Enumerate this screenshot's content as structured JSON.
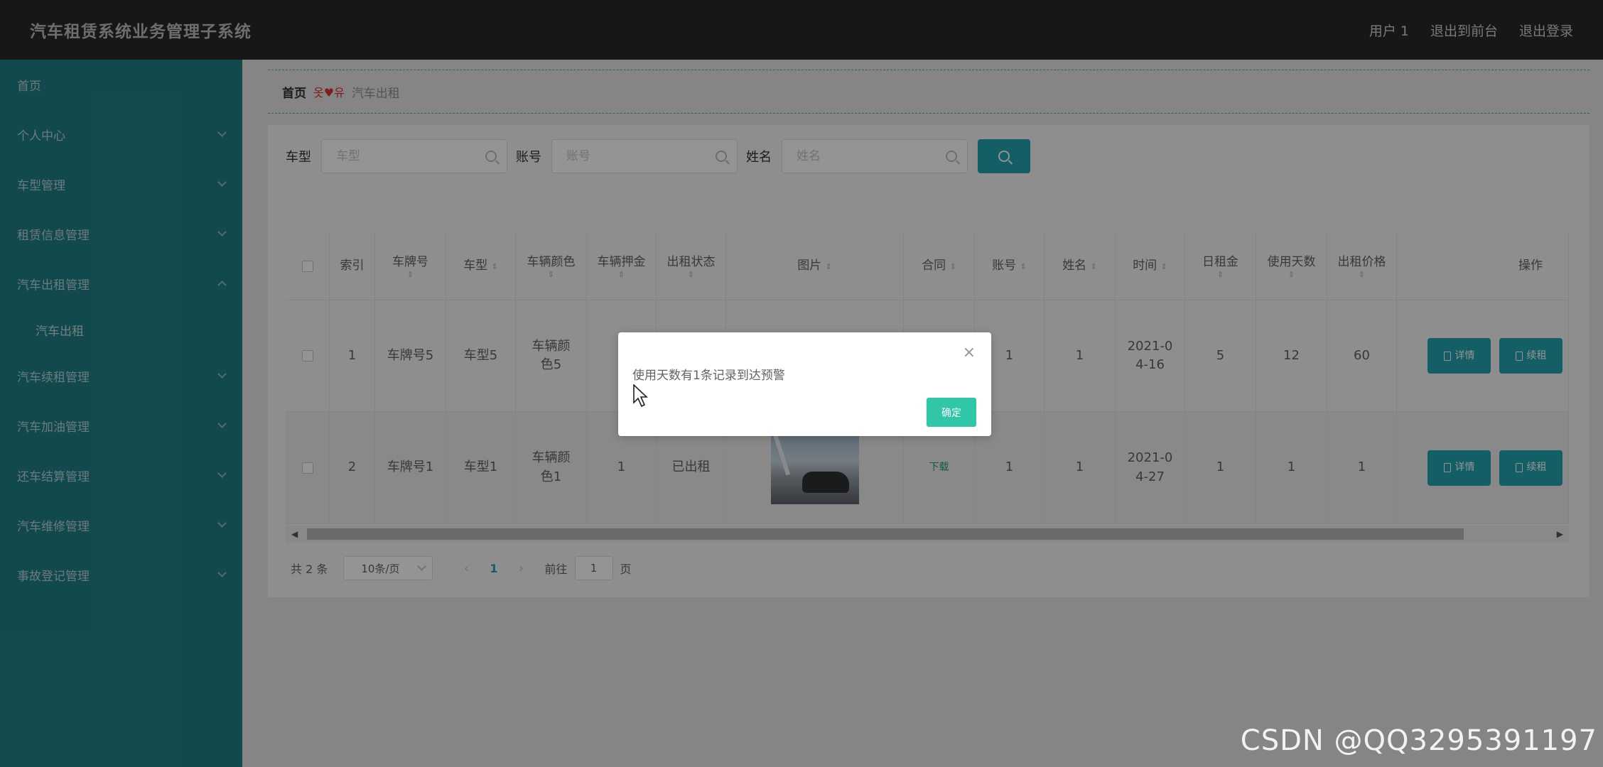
{
  "header": {
    "title": "汽车租赁系统业务管理子系统",
    "links": [
      "用户 1",
      "退出到前台",
      "退出登录"
    ]
  },
  "sidebar": {
    "items": [
      {
        "label": "首页"
      },
      {
        "label": "个人中心"
      },
      {
        "label": "车型管理"
      },
      {
        "label": "租赁信息管理"
      },
      {
        "label": "汽车出租管理"
      },
      {
        "label": "汽车出租"
      },
      {
        "label": "汽车续租管理"
      },
      {
        "label": "汽车加油管理"
      },
      {
        "label": "还车结算管理"
      },
      {
        "label": "汽车维修管理"
      },
      {
        "label": "事故登记管理"
      }
    ]
  },
  "breadcrumb": {
    "home": "首页",
    "separator": "♥",
    "current": "汽车出租"
  },
  "search": {
    "fields": [
      {
        "label": "车型",
        "placeholder": "车型"
      },
      {
        "label": "账号",
        "placeholder": "账号"
      },
      {
        "label": "姓名",
        "placeholder": "姓名"
      }
    ]
  },
  "table": {
    "columns": [
      "索引",
      "车牌号",
      "车型",
      "车辆颜色",
      "车辆押金",
      "出租状态",
      "图片",
      "合同",
      "账号",
      "姓名",
      "时间",
      "日租金",
      "使用天数",
      "出租价格",
      "操作"
    ],
    "rows": [
      {
        "index": "1",
        "plate": "车牌号5",
        "model": "车型5",
        "color": "车辆颜色5",
        "deposit": "",
        "status": "",
        "contract": "",
        "account": "1",
        "name": "1",
        "time": "2021-04-16",
        "daily_rent": "5",
        "days": "12",
        "price": "60",
        "ops": [
          "详情",
          "续租"
        ]
      },
      {
        "index": "2",
        "plate": "车牌号1",
        "model": "车型1",
        "color": "车辆颜色1",
        "deposit": "1",
        "status": "已出租",
        "contract": "下载",
        "account": "1",
        "name": "1",
        "time": "2021-04-27",
        "daily_rent": "1",
        "days": "1",
        "price": "1",
        "ops": [
          "详情",
          "续租"
        ]
      }
    ]
  },
  "pagination": {
    "total": "共 2 条",
    "page_size": "10条/页",
    "current_page": "1",
    "goto_label": "前往",
    "goto_value": "1",
    "page_suffix": "页"
  },
  "dialog": {
    "message": "使用天数有1条记录到达预警",
    "ok_label": "确定"
  },
  "watermark": "CSDN @QQ3295391197",
  "colors": {
    "header_bg": "#282828",
    "sidebar_bg": "#1f7f86",
    "accent": "#23a4b0",
    "confirm": "#2fc7a5"
  }
}
